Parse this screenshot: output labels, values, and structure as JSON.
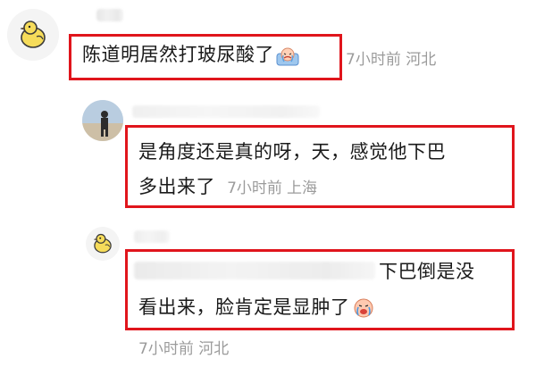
{
  "comments": [
    {
      "text": "陈道明居然打玻尿酸了",
      "time": "7小时前",
      "location": "河北",
      "avatar_icon": "yellow-chick-icon",
      "emoji": "crying-face-icon"
    },
    {
      "line1": "是角度还是真的呀，天，感觉他下巴",
      "line2": "多出来了",
      "time": "7小时前",
      "location": "上海",
      "avatar_icon": "beach-person-photo"
    },
    {
      "text_tail": "下巴倒是没",
      "line2": "看出来，脸肯定是显肿了",
      "time": "7小时前",
      "location": "河北",
      "avatar_icon": "yellow-chick-icon",
      "emoji": "crying-face-icon"
    }
  ],
  "colors": {
    "highlight_border": "#e0151c",
    "meta_text": "#9b9b9b"
  }
}
